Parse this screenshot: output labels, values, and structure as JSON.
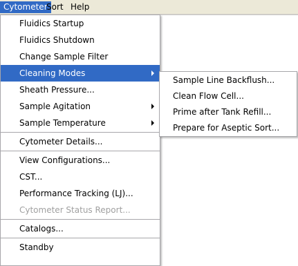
{
  "menubar": {
    "items": [
      {
        "label": "Cytometer"
      },
      {
        "label": "Sort"
      },
      {
        "label": "Help"
      }
    ]
  },
  "cytometer_menu": {
    "items": [
      {
        "label": "Fluidics Startup"
      },
      {
        "label": "Fluidics Shutdown"
      },
      {
        "label": "Change Sample Filter"
      },
      {
        "label": "Cleaning Modes"
      },
      {
        "label": "Sheath Pressure..."
      },
      {
        "label": "Sample Agitation"
      },
      {
        "label": "Sample Temperature"
      },
      {
        "label": "Cytometer Details..."
      },
      {
        "label": "View Configurations..."
      },
      {
        "label": "CST..."
      },
      {
        "label": "Performance Tracking (LJ)..."
      },
      {
        "label": "Cytometer Status Report..."
      },
      {
        "label": "Catalogs..."
      },
      {
        "label": "Standby"
      }
    ]
  },
  "cleaning_modes_submenu": {
    "items": [
      {
        "label": "Sample Line Backflush..."
      },
      {
        "label": "Clean Flow Cell..."
      },
      {
        "label": "Prime after Tank Refill..."
      },
      {
        "label": "Prepare for Aseptic Sort..."
      }
    ]
  },
  "colors": {
    "menubar_bg": "#ece9d8",
    "highlight": "#316ac5",
    "menu_border": "#a7a6aa",
    "disabled_text": "#a0a0a0"
  }
}
